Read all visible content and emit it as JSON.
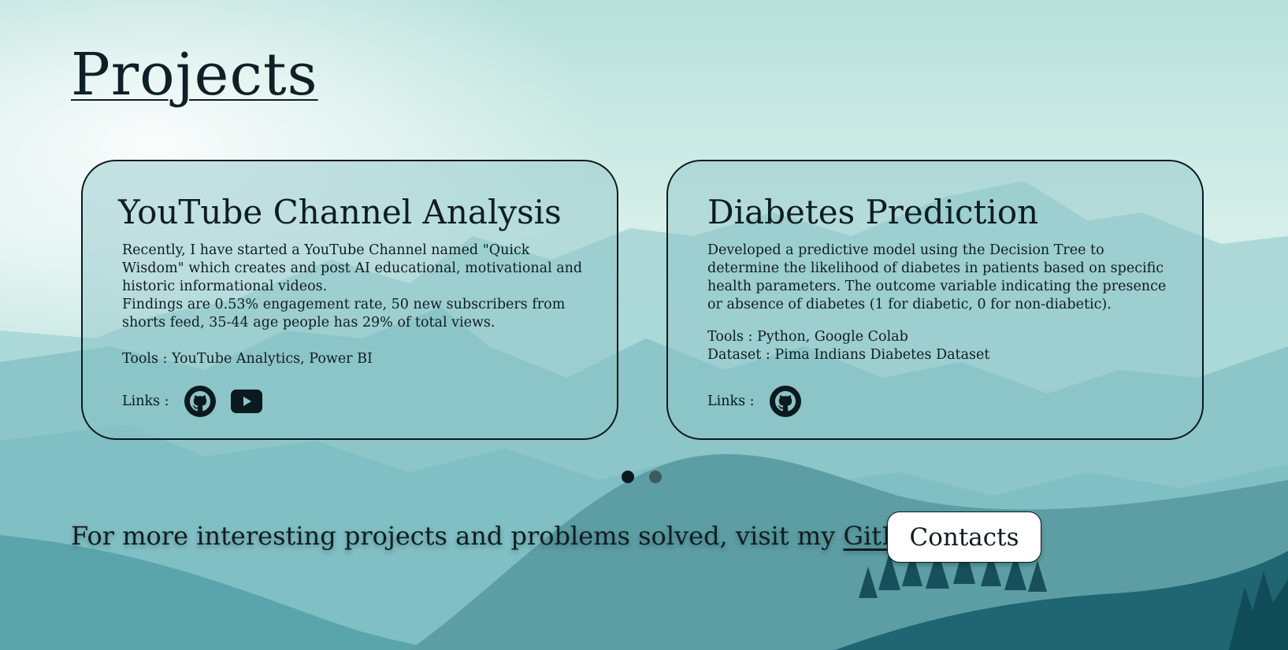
{
  "page": {
    "title": "Projects"
  },
  "projects": [
    {
      "title": "YouTube Channel Analysis",
      "description": "Recently, I have started a YouTube Channel named \"Quick Wisdom\" which creates and post AI educational, motivational and historic informational videos.",
      "findings": "Findings are 0.53% engagement rate, 50 new subscribers from shorts feed, 35-44 age people has 29% of total views.",
      "tools": "Tools : YouTube Analytics, Power BI",
      "links_label": "Links :",
      "links": [
        "github-icon",
        "youtube-icon"
      ]
    },
    {
      "title": "Diabetes Prediction",
      "description": "Developed a predictive model using the Decision Tree to determine the likelihood of diabetes in patients based on specific health parameters. The outcome variable indicating the presence or absence of diabetes (1 for diabetic, 0 for non-diabetic).",
      "tools": "Tools : Python, Google Colab",
      "dataset": "Dataset : Pima Indians Diabetes Dataset",
      "links_label": "Links :",
      "links": [
        "github-icon"
      ]
    }
  ],
  "carousel": {
    "pages": 2,
    "active": 1
  },
  "footer": {
    "text": "For more interesting projects and problems solved, visit my ",
    "link_text": "GitHub"
  },
  "contacts_button": {
    "label": "Contacts"
  },
  "colors": {
    "sky": "#c2e7e1",
    "mountain_light": "#8fcfcf",
    "mountain_mid": "#5fa9ad",
    "forest_dark": "#0f4c57",
    "text": "#0e1d22"
  }
}
